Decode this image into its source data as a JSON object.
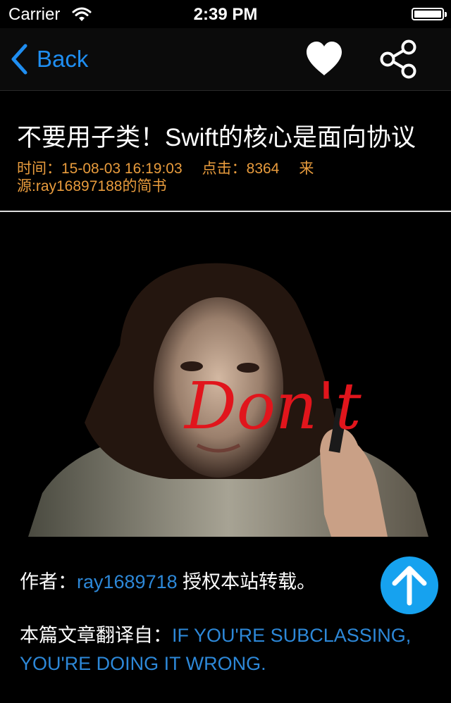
{
  "status_bar": {
    "carrier": "Carrier",
    "time": "2:39 PM"
  },
  "nav": {
    "back_label": "Back",
    "favorite_icon": "heart-icon",
    "share_icon": "share-icon",
    "accent_color": "#1f8ef1"
  },
  "article": {
    "title": "不要用子类！Swift的核心是面向协议",
    "meta": {
      "time": "时间：15-08-03 16:19:03",
      "clicks": "点击：8364",
      "source": "来源:ray16897188的简书"
    },
    "hero_image": {
      "overlay_text": "Don't"
    },
    "author_prefix": "作者：",
    "author_name": "ray1689718",
    "author_suffix": " 授权本站转载。",
    "translated_prefix": "本篇文章翻译自：",
    "translated_link": "IF YOU'RE SUBCLASSING, YOU'RE DOING IT WRONG."
  },
  "scroll_top": {
    "icon": "arrow-up-icon",
    "color": "#16a2ef"
  }
}
